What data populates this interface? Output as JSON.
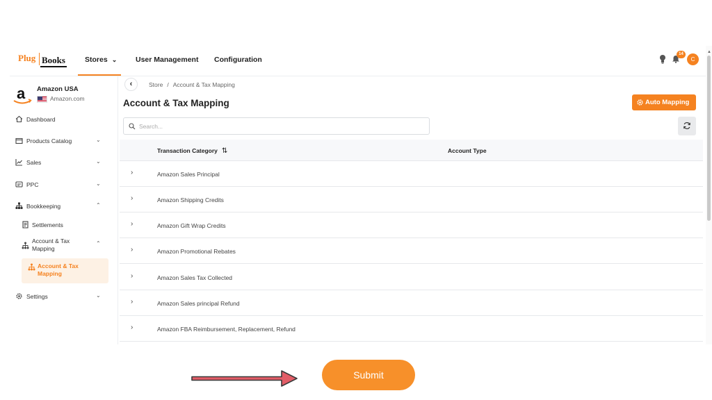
{
  "logo": {
    "part1": "Plug",
    "part2": "Books"
  },
  "topnav": {
    "stores": "Stores",
    "user_management": "User Management",
    "configuration": "Configuration",
    "notification_count": "14",
    "avatar_initial": "C"
  },
  "store": {
    "name": "Amazon USA",
    "domain": "Amazon.com"
  },
  "sidebar": {
    "dashboard": "Dashboard",
    "products_catalog": "Products Catalog",
    "sales": "Sales",
    "ppc": "PPC",
    "bookkeeping": "Bookkeeping",
    "settlements": "Settlements",
    "account_tax_mapping_parent": "Account & Tax Mapping",
    "account_tax_mapping_active": "Account & Tax Mapping",
    "settings": "Settings"
  },
  "breadcrumb": {
    "root": "Store",
    "separator": "/",
    "current": "Account & Tax Mapping"
  },
  "page": {
    "title": "Account & Tax Mapping",
    "auto_mapping": "Auto Mapping",
    "search_placeholder": "Search..."
  },
  "table": {
    "headers": {
      "category": "Transaction Category",
      "sort_icon": "⇅",
      "type": "Account Type"
    },
    "rows": [
      "Amazon Sales Principal",
      "Amazon Shipping Credits",
      "Amazon Gift Wrap Credits",
      "Amazon Promotional Rebates",
      "Amazon Sales Tax Collected",
      "Amazon Sales principal Refund",
      "Amazon FBA Reimbursement, Replacement, Refund"
    ]
  },
  "submit": "Submit",
  "colors": {
    "accent": "#f58220",
    "arrow": "#e25d67",
    "active_bg": "#fdf1e4"
  }
}
